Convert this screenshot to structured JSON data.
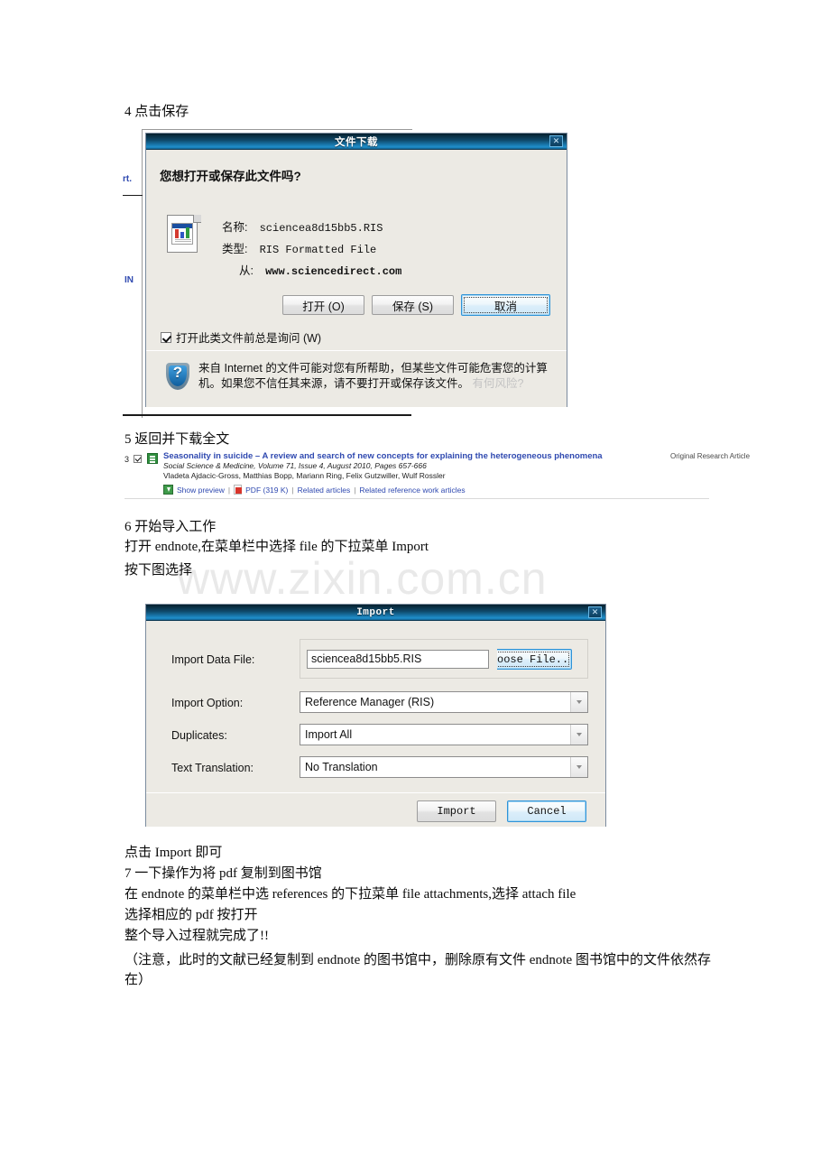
{
  "document": {
    "watermark": "www.zixin.com.cn",
    "step4_heading": "4 点击保存",
    "step5_heading": "5 返回并下载全文",
    "step6_heading": "6 开始导入工作",
    "step6_line1": "打开 endnote,在菜单栏中选择 file 的下拉菜单 Import",
    "step6_line2": "按下图选择",
    "after_import_line": "点击 Import 即可",
    "step7_heading": "7 一下操作为将 pdf 复制到图书馆",
    "step7_line1": "在 endnote 的菜单栏中选 references 的下拉菜单 file attachments,选择 attach file",
    "step7_line2": "选择相应的 pdf 按打开",
    "step7_line3": " 整个导入过程就完成了!!",
    "step7_note": "（注意，此时的文献已经复制到 endnote 的图书馆中，删除原有文件 endnote 图书馆中的文件依然存在）"
  },
  "background_fragments": {
    "frag1": "rt.",
    "frag2": "IN"
  },
  "file_download_dialog": {
    "title": "文件下载",
    "close_label": "✕",
    "question": "您想打开或保存此文件吗?",
    "fields": [
      {
        "label": "名称:",
        "value": "sciencea8d15bb5.RIS",
        "bold": false
      },
      {
        "label": "类型:",
        "value": "RIS Formatted File",
        "bold": false
      },
      {
        "label": "从:",
        "value": "www.sciencedirect.com",
        "bold": true
      }
    ],
    "buttons": {
      "open": "打开 (O)",
      "save": "保存 (S)",
      "cancel": "取消"
    },
    "checkbox_label": "打开此类文件前总是询问 (W)",
    "checkbox_checked": true,
    "warning_text": "来自 Internet 的文件可能对您有所帮助，但某些文件可能危害您的计算机。如果您不信任其来源，请不要打开或保存该文件。",
    "warning_link": "有何风险?",
    "icon": "ris-file-icon",
    "warning_icon": "blue-shield-question-icon"
  },
  "search_result": {
    "number": "3",
    "checked": true,
    "title": "Seasonality in  suicide  – A review and search of new concepts for explaining the heterogeneous phenomena",
    "article_type": "Original Research Article",
    "journal": "Social Science & Medicine, Volume 71, Issue 4, August 2010, Pages 657-666",
    "authors": "Vladeta Ajdacic-Gross, Matthias Bopp, Mariann Ring, Felix Gutzwiller, Wulf Rossler",
    "links": [
      "Show preview",
      "PDF (319 K)",
      "Related articles",
      "Related reference work articles"
    ],
    "link_color": "#2f49b0"
  },
  "import_dialog": {
    "title": "Import",
    "close_label": "✕",
    "rows": [
      {
        "label": "Import Data File:",
        "value": "sciencea8d15bb5.RIS"
      },
      {
        "label": "Import Option:",
        "value": "Reference Manager (RIS)"
      },
      {
        "label": "Duplicates:",
        "value": "Import All"
      },
      {
        "label": "Text Translation:",
        "value": "No Translation"
      }
    ],
    "choose_file_button": "ꓥoose File..",
    "buttons": {
      "import": "Import",
      "cancel": "Cancel"
    }
  }
}
